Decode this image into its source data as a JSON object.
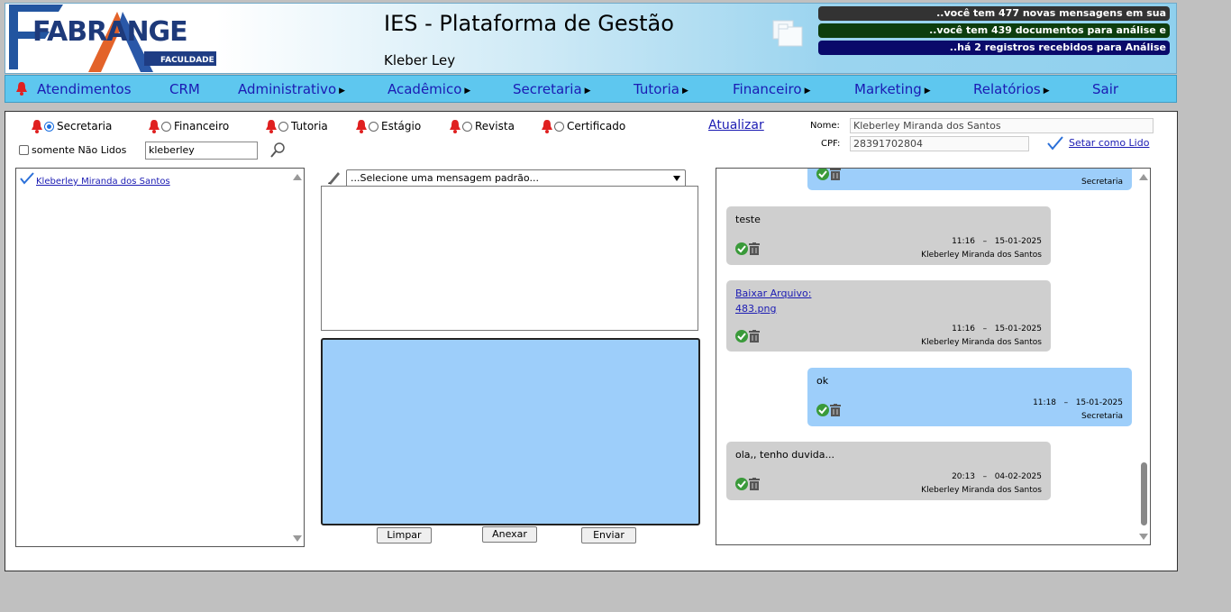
{
  "header": {
    "logo_text": "FABRANGE",
    "logo_subtext": "FACULDADE",
    "title": "IES - Plataforma de Gestão",
    "user": "Kleber Ley",
    "tickers": [
      "..você tem 477 novas mensagens em sua",
      "..você tem 439 documentos para análise e",
      "..há 2 registros recebidos para Análise"
    ]
  },
  "nav": {
    "items": [
      {
        "label": "Atendimentos",
        "has_bell": true,
        "has_submenu": false
      },
      {
        "label": "CRM",
        "has_submenu": false
      },
      {
        "label": "Administrativo",
        "has_submenu": true
      },
      {
        "label": "Acadêmico",
        "has_submenu": true
      },
      {
        "label": "Secretaria",
        "has_submenu": true
      },
      {
        "label": "Tutoria",
        "has_submenu": true
      },
      {
        "label": "Financeiro",
        "has_submenu": true
      },
      {
        "label": "Marketing",
        "has_submenu": true
      },
      {
        "label": "Relatórios",
        "has_submenu": true
      },
      {
        "label": "Sair",
        "has_submenu": false
      }
    ]
  },
  "filters": {
    "options": [
      {
        "label": "Secretaria",
        "selected": true
      },
      {
        "label": "Financeiro",
        "selected": false
      },
      {
        "label": "Tutoria",
        "selected": false
      },
      {
        "label": "Estágio",
        "selected": false
      },
      {
        "label": "Revista",
        "selected": false
      },
      {
        "label": "Certificado",
        "selected": false
      }
    ],
    "refresh_label": "Atualizar",
    "unread_only_label": "somente Não Lidos",
    "unread_only_checked": false,
    "search_value": "kleberley"
  },
  "student": {
    "name_label": "Nome:",
    "name_value": "Kleberley Miranda dos Santos",
    "cpf_label": "CPF:",
    "cpf_value": "28391702804",
    "set_read_label": "Setar como Lido"
  },
  "contacts": [
    {
      "name": "Kleberley Miranda dos Santos",
      "read": true
    }
  ],
  "composer": {
    "template_placeholder": "...Selecione uma mensagem padrão...",
    "message_value": "",
    "clear_label": "Limpar",
    "attach_label": "Anexar",
    "send_label": "Enviar"
  },
  "messages": [
    {
      "type": "sent",
      "text": "",
      "time": "",
      "date": "",
      "author": "Secretaria"
    },
    {
      "type": "recv",
      "text": "teste",
      "time": "11:16",
      "date": "15-01-2025",
      "author": "Kleberley Miranda dos Santos"
    },
    {
      "type": "recv",
      "link_text_1": "Baixar Arquivo:",
      "link_text_2": "483.png",
      "time": "11:16",
      "date": "15-01-2025",
      "author": "Kleberley Miranda dos Santos"
    },
    {
      "type": "sent",
      "text": "ok",
      "time": "11:18",
      "date": "15-01-2025",
      "author": "Secretaria"
    },
    {
      "type": "recv",
      "text": "ola,, tenho duvida...",
      "time": "20:13",
      "date": "04-02-2025",
      "author": "Kleberley Miranda dos Santos"
    }
  ],
  "colors": {
    "nav_bg": "#5ec7ef",
    "link": "#1b1bb3",
    "sent_bubble": "#9dcefa",
    "recv_bubble": "#cfcfcf",
    "bell": "#e02020"
  }
}
